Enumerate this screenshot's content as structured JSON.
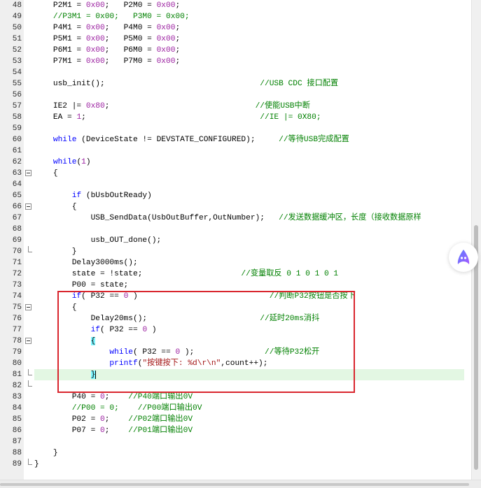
{
  "editor": {
    "lines": [
      {
        "n": "48",
        "segs": [
          [
            "t",
            "    P2M1 = "
          ],
          [
            "num",
            "0x00"
          ],
          [
            "t",
            ";   P2M0 = "
          ],
          [
            "num",
            "0x00"
          ],
          [
            "t",
            ";"
          ]
        ]
      },
      {
        "n": "49",
        "segs": [
          [
            "t",
            "    "
          ],
          [
            "cm",
            "//P3M1 = 0x00;   P3M0 = 0x00;"
          ]
        ]
      },
      {
        "n": "50",
        "segs": [
          [
            "t",
            "    P4M1 = "
          ],
          [
            "num",
            "0x00"
          ],
          [
            "t",
            ";   P4M0 = "
          ],
          [
            "num",
            "0x00"
          ],
          [
            "t",
            ";"
          ]
        ]
      },
      {
        "n": "51",
        "segs": [
          [
            "t",
            "    P5M1 = "
          ],
          [
            "num",
            "0x00"
          ],
          [
            "t",
            ";   P5M0 = "
          ],
          [
            "num",
            "0x00"
          ],
          [
            "t",
            ";"
          ]
        ]
      },
      {
        "n": "52",
        "segs": [
          [
            "t",
            "    P6M1 = "
          ],
          [
            "num",
            "0x00"
          ],
          [
            "t",
            ";   P6M0 = "
          ],
          [
            "num",
            "0x00"
          ],
          [
            "t",
            ";"
          ]
        ]
      },
      {
        "n": "53",
        "segs": [
          [
            "t",
            "    P7M1 = "
          ],
          [
            "num",
            "0x00"
          ],
          [
            "t",
            ";   P7M0 = "
          ],
          [
            "num",
            "0x00"
          ],
          [
            "t",
            ";"
          ]
        ]
      },
      {
        "n": "54",
        "segs": []
      },
      {
        "n": "55",
        "segs": [
          [
            "t",
            "    usb_init();                                 "
          ],
          [
            "cm",
            "//USB CDC 接口配置"
          ]
        ]
      },
      {
        "n": "56",
        "segs": []
      },
      {
        "n": "57",
        "segs": [
          [
            "t",
            "    IE2 |= "
          ],
          [
            "num",
            "0x80"
          ],
          [
            "t",
            ";                               "
          ],
          [
            "cm",
            "//使能USB中断"
          ]
        ]
      },
      {
        "n": "58",
        "segs": [
          [
            "t",
            "    EA = "
          ],
          [
            "num",
            "1"
          ],
          [
            "t",
            ";                                     "
          ],
          [
            "cm",
            "//IE |= 0X80;"
          ]
        ]
      },
      {
        "n": "59",
        "segs": []
      },
      {
        "n": "60",
        "segs": [
          [
            "t",
            "    "
          ],
          [
            "kw",
            "while"
          ],
          [
            "t",
            " (DeviceState != DEVSTATE_CONFIGURED);     "
          ],
          [
            "cm",
            "//等待USB完成配置"
          ]
        ]
      },
      {
        "n": "61",
        "segs": []
      },
      {
        "n": "62",
        "segs": [
          [
            "t",
            "    "
          ],
          [
            "kw",
            "while"
          ],
          [
            "t",
            "("
          ],
          [
            "num",
            "1"
          ],
          [
            "t",
            ")"
          ]
        ]
      },
      {
        "n": "63",
        "fold": "open",
        "segs": [
          [
            "t",
            "    {"
          ]
        ]
      },
      {
        "n": "64",
        "segs": []
      },
      {
        "n": "65",
        "segs": [
          [
            "t",
            "        "
          ],
          [
            "kw",
            "if"
          ],
          [
            "t",
            " (bUsbOutReady)"
          ]
        ]
      },
      {
        "n": "66",
        "fold": "open",
        "segs": [
          [
            "t",
            "        {"
          ]
        ]
      },
      {
        "n": "67",
        "segs": [
          [
            "t",
            "            USB_SendData(UsbOutBuffer,OutNumber);   "
          ],
          [
            "cm",
            "//发送数据缓冲区，长度（接收数据原样"
          ]
        ]
      },
      {
        "n": "68",
        "segs": []
      },
      {
        "n": "69",
        "segs": [
          [
            "t",
            "            usb_OUT_done();"
          ]
        ]
      },
      {
        "n": "70",
        "fold": "end",
        "segs": [
          [
            "t",
            "        }"
          ]
        ]
      },
      {
        "n": "71",
        "segs": [
          [
            "t",
            "        Delay3000ms();"
          ]
        ]
      },
      {
        "n": "72",
        "segs": [
          [
            "t",
            "        state = !state;                     "
          ],
          [
            "cm",
            "//变量取反 0 1 0 1 0 1"
          ]
        ]
      },
      {
        "n": "73",
        "segs": [
          [
            "t",
            "        P00 = state;"
          ]
        ]
      },
      {
        "n": "74",
        "segs": [
          [
            "t",
            "        "
          ],
          [
            "kw",
            "if"
          ],
          [
            "t",
            "( P32 == "
          ],
          [
            "num",
            "0"
          ],
          [
            "t",
            " )                            "
          ],
          [
            "cm",
            "//判断P32按钮是否按下"
          ]
        ]
      },
      {
        "n": "75",
        "fold": "open",
        "segs": [
          [
            "t",
            "        {"
          ]
        ]
      },
      {
        "n": "76",
        "segs": [
          [
            "t",
            "            Delay20ms();                        "
          ],
          [
            "cm",
            "//延时20ms消抖"
          ]
        ]
      },
      {
        "n": "77",
        "segs": [
          [
            "t",
            "            "
          ],
          [
            "kw",
            "if"
          ],
          [
            "t",
            "( P32 == "
          ],
          [
            "num",
            "0"
          ],
          [
            "t",
            " )"
          ]
        ]
      },
      {
        "n": "78",
        "fold": "open",
        "segs": [
          [
            "t",
            "            "
          ],
          [
            "br",
            "{"
          ]
        ]
      },
      {
        "n": "79",
        "segs": [
          [
            "t",
            "                "
          ],
          [
            "kw",
            "while"
          ],
          [
            "t",
            "( P32 == "
          ],
          [
            "num",
            "0"
          ],
          [
            "t",
            " );               "
          ],
          [
            "cm",
            "//等待P32松开"
          ]
        ]
      },
      {
        "n": "80",
        "segs": [
          [
            "t",
            "                "
          ],
          [
            "kw",
            "printf"
          ],
          [
            "t",
            "("
          ],
          [
            "str",
            "\"按键按下: %d\\r\\n\""
          ],
          [
            "t",
            ",count++);"
          ]
        ]
      },
      {
        "n": "81",
        "fold": "end",
        "highlight": true,
        "segs": [
          [
            "t",
            "            "
          ],
          [
            "brc",
            "}"
          ]
        ]
      },
      {
        "n": "82",
        "fold": "end",
        "segs": []
      },
      {
        "n": "83",
        "segs": [
          [
            "t",
            "        P40 = "
          ],
          [
            "num",
            "0"
          ],
          [
            "t",
            ";    "
          ],
          [
            "cm",
            "//P40端口输出0V"
          ]
        ]
      },
      {
        "n": "84",
        "segs": [
          [
            "t",
            "        "
          ],
          [
            "cm",
            "//P00 = 0;    //P00端口输出0V"
          ]
        ]
      },
      {
        "n": "85",
        "segs": [
          [
            "t",
            "        P02 = "
          ],
          [
            "num",
            "0"
          ],
          [
            "t",
            ";    "
          ],
          [
            "cm",
            "//P02端口输出0V"
          ]
        ]
      },
      {
        "n": "86",
        "segs": [
          [
            "t",
            "        P07 = "
          ],
          [
            "num",
            "0"
          ],
          [
            "t",
            ";    "
          ],
          [
            "cm",
            "//P01端口输出0V"
          ]
        ]
      },
      {
        "n": "87",
        "segs": []
      },
      {
        "n": "88",
        "segs": [
          [
            "t",
            "    }"
          ]
        ]
      },
      {
        "n": "89",
        "fold": "end",
        "segs": [
          [
            "t",
            "}"
          ]
        ]
      }
    ]
  },
  "colors": {
    "keyword": "#0000ff",
    "number": "#9b1fa0",
    "comment": "#008000",
    "string": "#a31515",
    "current_line": "#e3f7e3",
    "bracket_match": "#7ef5ff",
    "annotation_box": "#d9262e"
  },
  "floating_assistant": {
    "icon": "assistant-logo-icon"
  }
}
